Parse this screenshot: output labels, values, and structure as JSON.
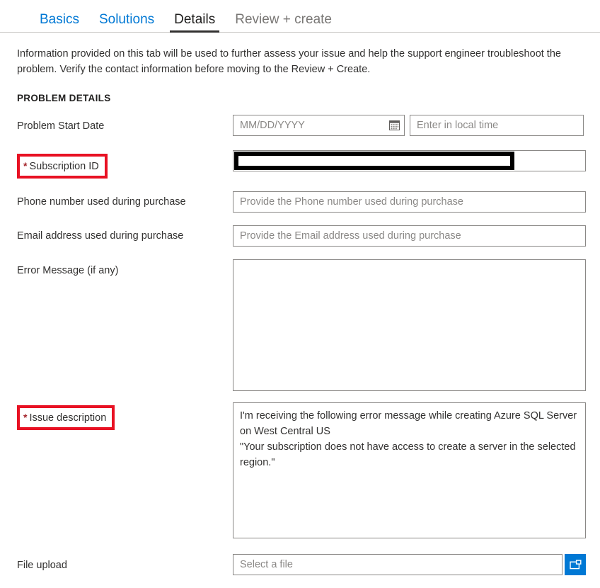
{
  "tabs": [
    {
      "label": "Basics",
      "state": "link"
    },
    {
      "label": "Solutions",
      "state": "link"
    },
    {
      "label": "Details",
      "state": "active"
    },
    {
      "label": "Review + create",
      "state": "muted"
    }
  ],
  "intro": "Information provided on this tab will be used to further assess your issue and help the support engineer troubleshoot the problem. Verify the contact information before moving to the Review + Create.",
  "section_title": "PROBLEM DETAILS",
  "fields": {
    "start_date": {
      "label": "Problem Start Date",
      "date_placeholder": "MM/DD/YYYY",
      "date_value": "",
      "time_placeholder": "Enter in local time",
      "time_value": "",
      "calendar_icon": "calendar-icon"
    },
    "subscription_id": {
      "label": "Subscription ID",
      "required": true,
      "required_marker": "*",
      "value": "",
      "redacted": true
    },
    "phone": {
      "label": "Phone number used during purchase",
      "placeholder": "Provide the Phone number used during purchase",
      "value": ""
    },
    "email": {
      "label": "Email address used during purchase",
      "placeholder": "Provide the Email address used during purchase",
      "value": ""
    },
    "error_message": {
      "label": "Error Message (if any)",
      "placeholder": "",
      "value": ""
    },
    "issue_description": {
      "label": "Issue description",
      "required": true,
      "required_marker": "*",
      "value": "I'm receiving the following error message while creating Azure SQL Server on West Central US\n\"Your subscription does not have access to create a server in the selected region.\""
    },
    "file_upload": {
      "label": "File upload",
      "placeholder": "Select a file",
      "value": "",
      "browse_icon": "folder-open-icon"
    }
  },
  "colors": {
    "tab_link": "#0078d4",
    "tab_active": "#201f1e",
    "tab_muted": "#797775",
    "required_highlight": "#e81123",
    "required_star": "#a4262c",
    "accent": "#0078d4",
    "border": "#8a8886",
    "redaction": "#000000"
  }
}
